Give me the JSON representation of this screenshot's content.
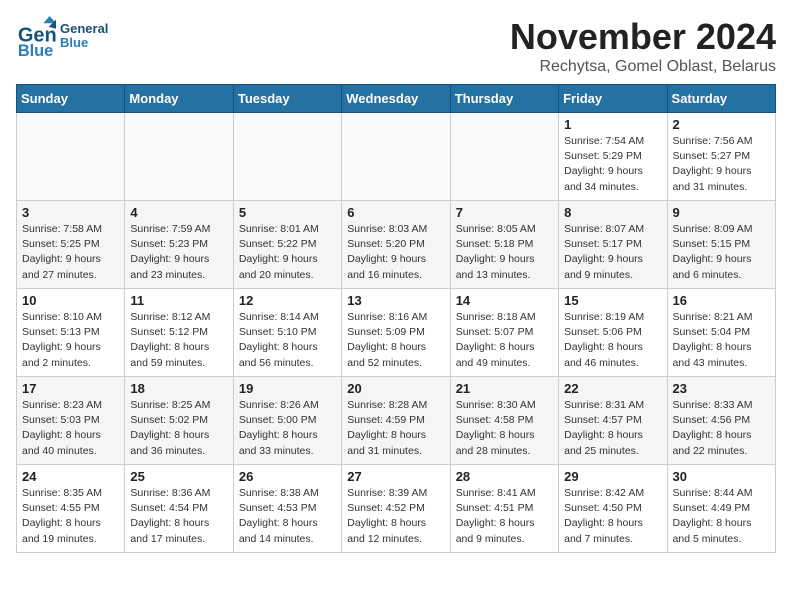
{
  "header": {
    "logo_line1": "General",
    "logo_line2": "Blue",
    "month": "November 2024",
    "location": "Rechytsa, Gomel Oblast, Belarus"
  },
  "days_of_week": [
    "Sunday",
    "Monday",
    "Tuesday",
    "Wednesday",
    "Thursday",
    "Friday",
    "Saturday"
  ],
  "weeks": [
    [
      {
        "num": "",
        "info": ""
      },
      {
        "num": "",
        "info": ""
      },
      {
        "num": "",
        "info": ""
      },
      {
        "num": "",
        "info": ""
      },
      {
        "num": "",
        "info": ""
      },
      {
        "num": "1",
        "info": "Sunrise: 7:54 AM\nSunset: 5:29 PM\nDaylight: 9 hours\nand 34 minutes."
      },
      {
        "num": "2",
        "info": "Sunrise: 7:56 AM\nSunset: 5:27 PM\nDaylight: 9 hours\nand 31 minutes."
      }
    ],
    [
      {
        "num": "3",
        "info": "Sunrise: 7:58 AM\nSunset: 5:25 PM\nDaylight: 9 hours\nand 27 minutes."
      },
      {
        "num": "4",
        "info": "Sunrise: 7:59 AM\nSunset: 5:23 PM\nDaylight: 9 hours\nand 23 minutes."
      },
      {
        "num": "5",
        "info": "Sunrise: 8:01 AM\nSunset: 5:22 PM\nDaylight: 9 hours\nand 20 minutes."
      },
      {
        "num": "6",
        "info": "Sunrise: 8:03 AM\nSunset: 5:20 PM\nDaylight: 9 hours\nand 16 minutes."
      },
      {
        "num": "7",
        "info": "Sunrise: 8:05 AM\nSunset: 5:18 PM\nDaylight: 9 hours\nand 13 minutes."
      },
      {
        "num": "8",
        "info": "Sunrise: 8:07 AM\nSunset: 5:17 PM\nDaylight: 9 hours\nand 9 minutes."
      },
      {
        "num": "9",
        "info": "Sunrise: 8:09 AM\nSunset: 5:15 PM\nDaylight: 9 hours\nand 6 minutes."
      }
    ],
    [
      {
        "num": "10",
        "info": "Sunrise: 8:10 AM\nSunset: 5:13 PM\nDaylight: 9 hours\nand 2 minutes."
      },
      {
        "num": "11",
        "info": "Sunrise: 8:12 AM\nSunset: 5:12 PM\nDaylight: 8 hours\nand 59 minutes."
      },
      {
        "num": "12",
        "info": "Sunrise: 8:14 AM\nSunset: 5:10 PM\nDaylight: 8 hours\nand 56 minutes."
      },
      {
        "num": "13",
        "info": "Sunrise: 8:16 AM\nSunset: 5:09 PM\nDaylight: 8 hours\nand 52 minutes."
      },
      {
        "num": "14",
        "info": "Sunrise: 8:18 AM\nSunset: 5:07 PM\nDaylight: 8 hours\nand 49 minutes."
      },
      {
        "num": "15",
        "info": "Sunrise: 8:19 AM\nSunset: 5:06 PM\nDaylight: 8 hours\nand 46 minutes."
      },
      {
        "num": "16",
        "info": "Sunrise: 8:21 AM\nSunset: 5:04 PM\nDaylight: 8 hours\nand 43 minutes."
      }
    ],
    [
      {
        "num": "17",
        "info": "Sunrise: 8:23 AM\nSunset: 5:03 PM\nDaylight: 8 hours\nand 40 minutes."
      },
      {
        "num": "18",
        "info": "Sunrise: 8:25 AM\nSunset: 5:02 PM\nDaylight: 8 hours\nand 36 minutes."
      },
      {
        "num": "19",
        "info": "Sunrise: 8:26 AM\nSunset: 5:00 PM\nDaylight: 8 hours\nand 33 minutes."
      },
      {
        "num": "20",
        "info": "Sunrise: 8:28 AM\nSunset: 4:59 PM\nDaylight: 8 hours\nand 31 minutes."
      },
      {
        "num": "21",
        "info": "Sunrise: 8:30 AM\nSunset: 4:58 PM\nDaylight: 8 hours\nand 28 minutes."
      },
      {
        "num": "22",
        "info": "Sunrise: 8:31 AM\nSunset: 4:57 PM\nDaylight: 8 hours\nand 25 minutes."
      },
      {
        "num": "23",
        "info": "Sunrise: 8:33 AM\nSunset: 4:56 PM\nDaylight: 8 hours\nand 22 minutes."
      }
    ],
    [
      {
        "num": "24",
        "info": "Sunrise: 8:35 AM\nSunset: 4:55 PM\nDaylight: 8 hours\nand 19 minutes."
      },
      {
        "num": "25",
        "info": "Sunrise: 8:36 AM\nSunset: 4:54 PM\nDaylight: 8 hours\nand 17 minutes."
      },
      {
        "num": "26",
        "info": "Sunrise: 8:38 AM\nSunset: 4:53 PM\nDaylight: 8 hours\nand 14 minutes."
      },
      {
        "num": "27",
        "info": "Sunrise: 8:39 AM\nSunset: 4:52 PM\nDaylight: 8 hours\nand 12 minutes."
      },
      {
        "num": "28",
        "info": "Sunrise: 8:41 AM\nSunset: 4:51 PM\nDaylight: 8 hours\nand 9 minutes."
      },
      {
        "num": "29",
        "info": "Sunrise: 8:42 AM\nSunset: 4:50 PM\nDaylight: 8 hours\nand 7 minutes."
      },
      {
        "num": "30",
        "info": "Sunrise: 8:44 AM\nSunset: 4:49 PM\nDaylight: 8 hours\nand 5 minutes."
      }
    ]
  ]
}
